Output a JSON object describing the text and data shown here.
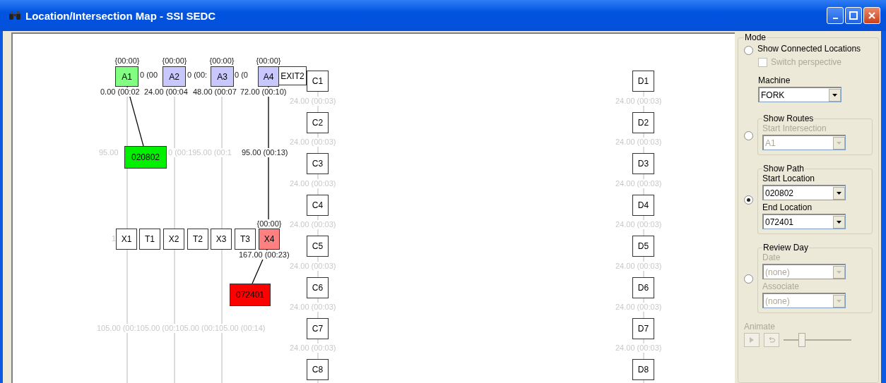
{
  "window": {
    "title": "Location/Intersection Map - SSI SEDC"
  },
  "canvas": {
    "nodes": [
      {
        "label": "A1",
        "color": "#80ff80"
      },
      {
        "label": "A2",
        "color": "#c8c8ff"
      },
      {
        "label": "A3",
        "color": "#c8c8ff"
      },
      {
        "label": "A4",
        "color": "#c8c8ff"
      },
      {
        "label": "C1",
        "color": "#ffffff"
      },
      {
        "label": "EXIT2",
        "color": "#ffffff"
      },
      {
        "label": "C2",
        "color": "#ffffff"
      },
      {
        "label": "C3",
        "color": "#ffffff"
      },
      {
        "label": "C4",
        "color": "#ffffff"
      },
      {
        "label": "C5",
        "color": "#ffffff"
      },
      {
        "label": "C6",
        "color": "#ffffff"
      },
      {
        "label": "C7",
        "color": "#ffffff"
      },
      {
        "label": "C8",
        "color": "#ffffff"
      },
      {
        "label": "D1",
        "color": "#ffffff"
      },
      {
        "label": "D2",
        "color": "#ffffff"
      },
      {
        "label": "D3",
        "color": "#ffffff"
      },
      {
        "label": "D4",
        "color": "#ffffff"
      },
      {
        "label": "D5",
        "color": "#ffffff"
      },
      {
        "label": "D6",
        "color": "#ffffff"
      },
      {
        "label": "D7",
        "color": "#ffffff"
      },
      {
        "label": "D8",
        "color": "#ffffff"
      },
      {
        "label": "X1",
        "color": "#ffffff"
      },
      {
        "label": "T1",
        "color": "#ffffff"
      },
      {
        "label": "X2",
        "color": "#ffffff"
      },
      {
        "label": "T2",
        "color": "#ffffff"
      },
      {
        "label": "X3",
        "color": "#ffffff"
      },
      {
        "label": "T3",
        "color": "#ffffff"
      },
      {
        "label": "X4",
        "color": "#ff8080"
      },
      {
        "label": "020802",
        "color": "#00f000"
      },
      {
        "label": "072401",
        "color": "#ff0000"
      }
    ],
    "labels": [
      {
        "text": "{00:00}",
        "dimmed": false
      },
      {
        "text": "{00:00}",
        "dimmed": false
      },
      {
        "text": "{00:00}",
        "dimmed": false
      },
      {
        "text": "{00:00}",
        "dimmed": false
      },
      {
        "text": "{00:00}",
        "dimmed": false
      },
      {
        "text": "0 (00",
        "dimmed": false
      },
      {
        "text": "0 (00:",
        "dimmed": false
      },
      {
        "text": "0 (0",
        "dimmed": false
      },
      {
        "text": "0.00 (00:02",
        "dimmed": false
      },
      {
        "text": "24.00 (00:04",
        "dimmed": false
      },
      {
        "text": "48.00 (00:07",
        "dimmed": false
      },
      {
        "text": "72.00 (00:10)",
        "dimmed": false
      },
      {
        "text": "24.00 (00:03)",
        "dimmed": true
      },
      {
        "text": "24.00 (00:03)",
        "dimmed": true
      },
      {
        "text": "24.00 (00:03)",
        "dimmed": true
      },
      {
        "text": "24.00 (00:03)",
        "dimmed": true
      },
      {
        "text": "24.00 (00:03)",
        "dimmed": true
      },
      {
        "text": "24.00 (00:03)",
        "dimmed": true
      },
      {
        "text": "24.00 (00:03)",
        "dimmed": true
      },
      {
        "text": "24.00 (00:03)",
        "dimmed": true
      },
      {
        "text": "24.00 (00:03)",
        "dimmed": true
      },
      {
        "text": "24.00 (00:03)",
        "dimmed": true
      },
      {
        "text": "24.00 (00:03)",
        "dimmed": true
      },
      {
        "text": "24.00 (00:03)",
        "dimmed": true
      },
      {
        "text": "24.00 (00:03)",
        "dimmed": true
      },
      {
        "text": "24.00 (00:03)",
        "dimmed": true
      },
      {
        "text": "95.00",
        "dimmed": true
      },
      {
        "text": "0 (00:195.00 (00:1",
        "dimmed": true
      },
      {
        "text": "95.00 (00:13)",
        "dimmed": false
      },
      {
        "text": "1",
        "dimmed": true
      },
      {
        "text": "167.00 (00:23)",
        "dimmed": false
      },
      {
        "text": "105.00 (00:105.00 (00:105.00 (00:105.00 (00:14)",
        "dimmed": true
      }
    ]
  },
  "panel": {
    "title": "Mode",
    "options": [
      {
        "kind": "connected",
        "label": "Show Connected Locations",
        "selected": false,
        "checkbox": {
          "label": "Switch perspective",
          "checked": false,
          "disabled": true
        },
        "fields": [
          {
            "label": "Machine",
            "value": "FORK",
            "disabled": false
          }
        ]
      },
      {
        "kind": "group",
        "label": "Show Routes",
        "selected": false,
        "fields": [
          {
            "label": "Start Intersection",
            "value": "A1",
            "disabled": true
          }
        ]
      },
      {
        "kind": "group",
        "label": "Show Path",
        "selected": true,
        "fields": [
          {
            "label": "Start Location",
            "value": "020802",
            "disabled": false
          },
          {
            "label": "End Location",
            "value": "072401",
            "disabled": false
          }
        ]
      },
      {
        "kind": "group",
        "label": "Review Day",
        "selected": false,
        "fields": [
          {
            "label": "Date",
            "value": "(none)",
            "disabled": true
          },
          {
            "label": "Associate",
            "value": "(none)",
            "disabled": true
          }
        ]
      }
    ],
    "animate": {
      "label": "Animate",
      "disabled": true,
      "level": 0.27
    }
  }
}
